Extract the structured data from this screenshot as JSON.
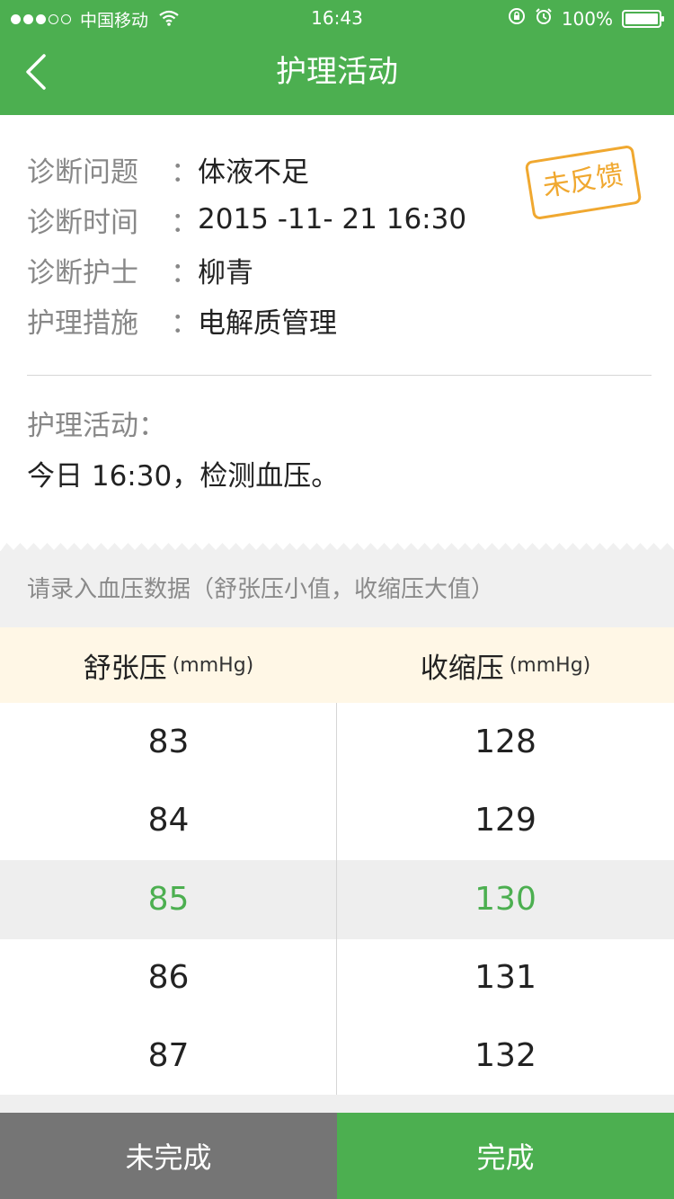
{
  "status_bar": {
    "carrier": "中国移动",
    "time": "16:43",
    "battery": "100%"
  },
  "nav": {
    "title": "护理活动"
  },
  "info": {
    "rows": [
      {
        "label": "诊断问题",
        "colon": "：",
        "value": "体液不足"
      },
      {
        "label": "诊断时间",
        "colon": "：",
        "value": "2015 -11- 21 16:30"
      },
      {
        "label": "诊断护士",
        "colon": "：",
        "value": "柳青"
      },
      {
        "label": "护理措施",
        "colon": "：",
        "value": "电解质管理"
      }
    ],
    "stamp": "未反馈"
  },
  "activity": {
    "label": "护理活动：",
    "text": "今日 16:30，检测血压。"
  },
  "input": {
    "hint": "请录入血压数据（舒张压小值，收缩压大值）"
  },
  "columns": [
    {
      "title": "舒张压",
      "unit": "(mmHg)"
    },
    {
      "title": "收缩压",
      "unit": "(mmHg)"
    }
  ],
  "picker": {
    "diastolic": [
      "83",
      "84",
      "85",
      "86",
      "87"
    ],
    "systolic": [
      "128",
      "129",
      "130",
      "131",
      "132"
    ],
    "selected_index": 2
  },
  "buttons": {
    "undone": "未完成",
    "done": "完成"
  },
  "colors": {
    "primary": "#4caf50",
    "stamp": "#f0a830",
    "undone_button": "#757575",
    "header_bg": "#fff7e6"
  }
}
